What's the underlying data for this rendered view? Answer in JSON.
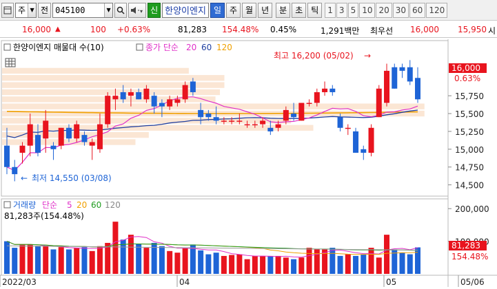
{
  "toolbar": {
    "market_type": "주",
    "market_type_short": "전",
    "stock_code": "045100",
    "stock_badge": "신",
    "stock_name": "한양이엔지",
    "periods": [
      "일",
      "주",
      "월",
      "년",
      "분",
      "초",
      "틱"
    ],
    "active_period": "일",
    "intervals": [
      "1",
      "3",
      "5",
      "10",
      "20",
      "30",
      "60",
      "120"
    ]
  },
  "quote": {
    "price": "16,000",
    "change": "100",
    "change_pct": "+0.63%",
    "volume": "81,283",
    "volume_ratio": "154.48%",
    "turnover": "0.45%",
    "trade_value": "1,291백만",
    "bid_label": "최우선",
    "ask_price": "16,000",
    "bid_price": "15,950",
    "extra": "시"
  },
  "price_panel": {
    "legend_title": "한양이엔지 매물대 수(10)",
    "ma_label": "종가 단순",
    "ma_periods": [
      "20",
      "60",
      "120"
    ],
    "high_note": "최고 16,200 (05/02)",
    "low_note": "최저 14,550 (03/08)",
    "current_price_tag": "16,000",
    "current_pct_tag": "0.63%",
    "y_ticks": [
      "15,750",
      "15,500",
      "15,250",
      "15,000",
      "14,750",
      "14,500"
    ]
  },
  "volume_panel": {
    "legend_title": "거래량",
    "ma_label": "단순",
    "ma_periods": [
      "5",
      "20",
      "60",
      "120"
    ],
    "current_volume_text": "81,283주(154.48%)",
    "current_volume_tag": "81,283",
    "current_pct_tag": "154.48%",
    "y_ticks": [
      "200,000",
      "100,000"
    ]
  },
  "x_axis": [
    "2022/03",
    "04",
    "05",
    "05/06"
  ],
  "colors": {
    "up": "#e8141e",
    "down": "#1e64d6",
    "ma20": "#e030c8",
    "ma60": "#1f3fa0",
    "ma120": "#f0a000",
    "volume_profile": "#fbe6d4"
  },
  "chart_data": {
    "type": "candlestick",
    "candles": [
      {
        "o": 15050,
        "h": 15300,
        "l": 14650,
        "c": 14750
      },
      {
        "o": 14750,
        "h": 14850,
        "l": 14550,
        "c": 14650
      },
      {
        "o": 14950,
        "h": 15100,
        "l": 14800,
        "c": 15050
      },
      {
        "o": 15050,
        "h": 15500,
        "l": 14900,
        "c": 15350
      },
      {
        "o": 15200,
        "h": 15350,
        "l": 14900,
        "c": 14950
      },
      {
        "o": 15150,
        "h": 15550,
        "l": 14950,
        "c": 15400
      },
      {
        "o": 15050,
        "h": 15100,
        "l": 14850,
        "c": 15000
      },
      {
        "o": 15050,
        "h": 15300,
        "l": 15000,
        "c": 15300
      },
      {
        "o": 15300,
        "h": 15350,
        "l": 15100,
        "c": 15150
      },
      {
        "o": 15150,
        "h": 15400,
        "l": 15100,
        "c": 15350
      },
      {
        "o": 15200,
        "h": 15250,
        "l": 15050,
        "c": 15100
      },
      {
        "o": 15050,
        "h": 15150,
        "l": 14850,
        "c": 15100
      },
      {
        "o": 15000,
        "h": 15500,
        "l": 14950,
        "c": 15350
      },
      {
        "o": 15350,
        "h": 15800,
        "l": 15300,
        "c": 15750
      },
      {
        "o": 15700,
        "h": 15850,
        "l": 15550,
        "c": 15750
      },
      {
        "o": 15800,
        "h": 15900,
        "l": 15650,
        "c": 15700
      },
      {
        "o": 15750,
        "h": 15850,
        "l": 15600,
        "c": 15800
      },
      {
        "o": 15800,
        "h": 15850,
        "l": 15700,
        "c": 15700
      },
      {
        "o": 15700,
        "h": 15900,
        "l": 15650,
        "c": 15850
      },
      {
        "o": 15750,
        "h": 15800,
        "l": 15500,
        "c": 15600
      },
      {
        "o": 15650,
        "h": 15700,
        "l": 15450,
        "c": 15600
      },
      {
        "o": 15600,
        "h": 15750,
        "l": 15550,
        "c": 15700
      },
      {
        "o": 15650,
        "h": 15750,
        "l": 15600,
        "c": 15700
      },
      {
        "o": 15700,
        "h": 15950,
        "l": 15650,
        "c": 15900
      },
      {
        "o": 15950,
        "h": 16000,
        "l": 15750,
        "c": 15800
      },
      {
        "o": 15550,
        "h": 15650,
        "l": 15350,
        "c": 15450
      },
      {
        "o": 15500,
        "h": 15550,
        "l": 15400,
        "c": 15450
      },
      {
        "o": 15450,
        "h": 15600,
        "l": 15350,
        "c": 15400
      },
      {
        "o": 15400,
        "h": 15450,
        "l": 15350,
        "c": 15400
      },
      {
        "o": 15400,
        "h": 15450,
        "l": 15350,
        "c": 15400
      },
      {
        "o": 15400,
        "h": 15500,
        "l": 15350,
        "c": 15400
      },
      {
        "o": 15350,
        "h": 15400,
        "l": 15300,
        "c": 15350
      },
      {
        "o": 15350,
        "h": 15400,
        "l": 15300,
        "c": 15350
      },
      {
        "o": 15350,
        "h": 15450,
        "l": 15300,
        "c": 15400
      },
      {
        "o": 15300,
        "h": 15400,
        "l": 15200,
        "c": 15250
      },
      {
        "o": 15300,
        "h": 15400,
        "l": 15250,
        "c": 15350
      },
      {
        "o": 15400,
        "h": 15600,
        "l": 15350,
        "c": 15550
      },
      {
        "o": 15500,
        "h": 15650,
        "l": 15400,
        "c": 15450
      },
      {
        "o": 15400,
        "h": 15650,
        "l": 15400,
        "c": 15650
      },
      {
        "o": 15650,
        "h": 15700,
        "l": 15600,
        "c": 15650
      },
      {
        "o": 15650,
        "h": 15850,
        "l": 15600,
        "c": 15800
      },
      {
        "o": 15800,
        "h": 15950,
        "l": 15750,
        "c": 15850
      },
      {
        "o": 15850,
        "h": 15900,
        "l": 15750,
        "c": 15800
      },
      {
        "o": 15450,
        "h": 15500,
        "l": 15250,
        "c": 15300
      },
      {
        "o": 15300,
        "h": 15350,
        "l": 15200,
        "c": 15300
      },
      {
        "o": 15250,
        "h": 15300,
        "l": 14950,
        "c": 14950
      },
      {
        "o": 15000,
        "h": 15050,
        "l": 14850,
        "c": 14950
      },
      {
        "o": 14950,
        "h": 15350,
        "l": 14900,
        "c": 15300
      },
      {
        "o": 15450,
        "h": 15900,
        "l": 15450,
        "c": 15850
      },
      {
        "o": 15650,
        "h": 16200,
        "l": 15600,
        "c": 16100
      },
      {
        "o": 16150,
        "h": 16200,
        "l": 15850,
        "c": 15850
      },
      {
        "o": 16150,
        "h": 16200,
        "l": 16000,
        "c": 16100
      },
      {
        "o": 16150,
        "h": 16250,
        "l": 15900,
        "c": 15950
      },
      {
        "o": 16000,
        "h": 16150,
        "l": 15650,
        "c": 15700
      }
    ],
    "volume": [
      100000,
      80000,
      90000,
      90000,
      85000,
      85000,
      75000,
      82000,
      75000,
      80000,
      82000,
      70000,
      85000,
      95000,
      160000,
      105000,
      120000,
      92000,
      80000,
      95000,
      85000,
      70000,
      65000,
      80000,
      90000,
      72000,
      60000,
      65000,
      55000,
      58000,
      60000,
      45000,
      55000,
      55000,
      55000,
      55000,
      50000,
      45000,
      50000,
      80000,
      75000,
      75000,
      80000,
      55000,
      60000,
      55000,
      60000,
      80000,
      50000,
      120000,
      75000,
      65000,
      60000,
      81283
    ],
    "y_range": [
      14400,
      16350
    ],
    "volume_range": [
      0,
      230000
    ]
  }
}
